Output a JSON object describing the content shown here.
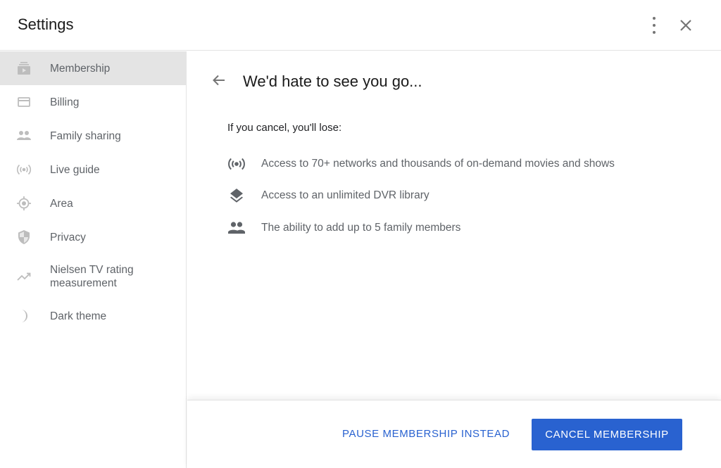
{
  "header": {
    "title": "Settings",
    "more_icon": "more-vert-icon",
    "close_icon": "close-icon"
  },
  "sidebar": {
    "items": [
      {
        "label": "Membership",
        "icon": "membership-icon",
        "active": true
      },
      {
        "label": "Billing",
        "icon": "credit-card-icon",
        "active": false
      },
      {
        "label": "Family sharing",
        "icon": "people-icon",
        "active": false
      },
      {
        "label": "Live guide",
        "icon": "live-broadcast-icon",
        "active": false
      },
      {
        "label": "Area",
        "icon": "location-target-icon",
        "active": false
      },
      {
        "label": "Privacy",
        "icon": "shield-icon",
        "active": false
      },
      {
        "label": "Nielsen TV rating measurement",
        "icon": "trending-up-icon",
        "active": false
      },
      {
        "label": "Dark theme",
        "icon": "moon-icon",
        "active": false
      }
    ]
  },
  "main": {
    "back_icon": "arrow-back-icon",
    "heading": "We'd hate to see you go...",
    "intro": "If you cancel, you'll lose:",
    "features": [
      {
        "icon": "live-broadcast-icon",
        "text": "Access to 70+ networks and thousands of on-demand movies and shows"
      },
      {
        "icon": "layers-icon",
        "text": "Access to an unlimited DVR library"
      },
      {
        "icon": "people-icon",
        "text": "The ability to add up to 5 family members"
      }
    ]
  },
  "footer": {
    "pause_label": "PAUSE MEMBERSHIP INSTEAD",
    "cancel_label": "CANCEL MEMBERSHIP"
  },
  "colors": {
    "accent": "#2962d0",
    "active_bg": "#e4e4e4",
    "icon_gray": "#bdbdbd",
    "text_gray": "#5f6368"
  }
}
